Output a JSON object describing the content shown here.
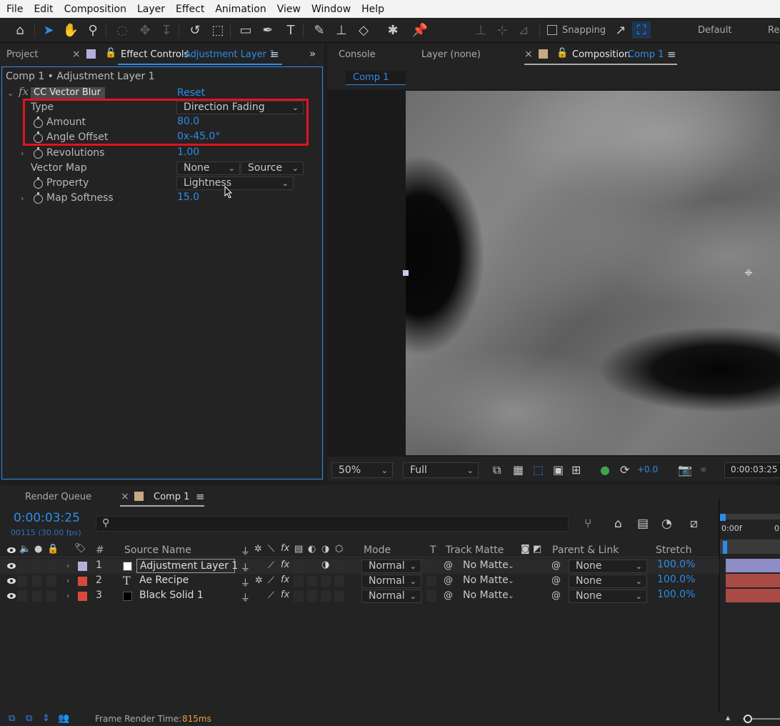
{
  "menu": [
    "File",
    "Edit",
    "Composition",
    "Layer",
    "Effect",
    "Animation",
    "View",
    "Window",
    "Help"
  ],
  "toolbar": {
    "snapping_label": "Snapping",
    "workspace": "Default",
    "workspace2": "Re"
  },
  "left_panel": {
    "tab_project": "Project",
    "tab_effect_controls": "Effect Controls",
    "tab_effect_controls_target": "Adjustment Layer 1",
    "breadcrumb": "Comp 1 • Adjustment Layer 1",
    "effect_name": "CC Vector Blur",
    "reset_label": "Reset",
    "properties": {
      "type_label": "Type",
      "type_value": "Direction Fading",
      "amount_label": "Amount",
      "amount_value": "80.0",
      "angle_label": "Angle Offset",
      "angle_value": "0x-45.0°",
      "revolutions_label": "Revolutions",
      "revolutions_value": "1.00",
      "vector_map_label": "Vector Map",
      "vector_map_layer": "None",
      "vector_map_source": "Source",
      "property_label": "Property",
      "property_value": "Lightness",
      "map_softness_label": "Map Softness",
      "map_softness_value": "15.0"
    },
    "highlight_color": "#e0141e"
  },
  "comp_panel": {
    "tab_console": "Console",
    "tab_layer": "Layer (none)",
    "tab_composition": "Composition",
    "tab_composition_target": "Comp 1",
    "subtab": "Comp 1",
    "zoom": "50%",
    "resolution": "Full",
    "exposure": "+0.0",
    "timecode": "0:00:03:25"
  },
  "timeline": {
    "tab_render_queue": "Render Queue",
    "tab_comp": "Comp 1",
    "current_time": "0:00:03:25",
    "frame_info": "00115 (30.00 fps)",
    "search_placeholder": "",
    "columns": {
      "num": "#",
      "source_name": "Source Name",
      "mode": "Mode",
      "t": "T",
      "track_matte": "Track Matte",
      "parent": "Parent & Link",
      "stretch": "Stretch"
    },
    "ruler_start": "0:00f",
    "ruler_next": "0",
    "layers": [
      {
        "num": "1",
        "name": "Adjustment Layer 1",
        "label_color": "#b3b0e0",
        "swatch": "#ffffff",
        "mode": "Normal",
        "matte": "No Matte",
        "parent": "None",
        "stretch": "100.0%",
        "bar_color": "#8e8cc6"
      },
      {
        "num": "2",
        "name": "Ae Recipe",
        "label_color": "#d9493b",
        "swatch": "T",
        "mode": "Normal",
        "matte": "No Matte",
        "parent": "None",
        "stretch": "100.0%",
        "bar_color": "#a94a45"
      },
      {
        "num": "3",
        "name": "Black Solid 1",
        "label_color": "#d9493b",
        "swatch": "#000000",
        "mode": "Normal",
        "matte": "No Matte",
        "parent": "None",
        "stretch": "100.0%",
        "bar_color": "#a94a45"
      }
    ],
    "render_time_label": "Frame Render Time:",
    "render_time_value": "815ms"
  }
}
